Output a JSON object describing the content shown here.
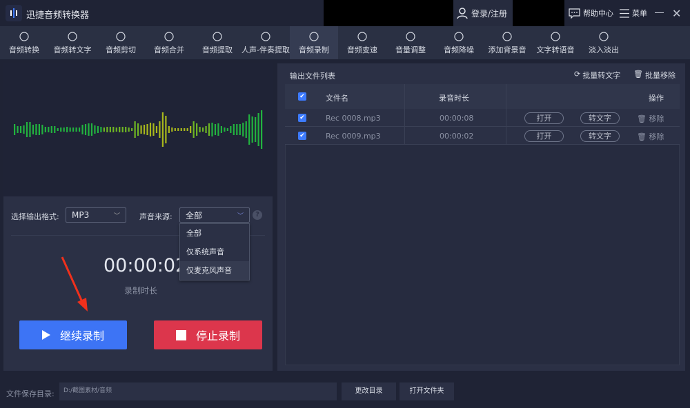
{
  "app": {
    "title": "迅捷音频转换器"
  },
  "titlebar": {
    "login": "登录/注册",
    "help": "帮助中心",
    "menu": "菜单"
  },
  "toolbar": {
    "items": [
      {
        "label": "音频转换",
        "icon": "audio-convert-icon"
      },
      {
        "label": "音频转文字",
        "icon": "speech-to-text-icon"
      },
      {
        "label": "音频剪切",
        "icon": "scissors-icon"
      },
      {
        "label": "音频合并",
        "icon": "merge-icon"
      },
      {
        "label": "音频提取",
        "icon": "extract-icon"
      },
      {
        "label": "人声-伴奏提取",
        "icon": "vocal-separate-icon"
      },
      {
        "label": "音频录制",
        "icon": "microphone-icon",
        "active": true
      },
      {
        "label": "音频变速",
        "icon": "speed-icon"
      },
      {
        "label": "音量调整",
        "icon": "volume-icon"
      },
      {
        "label": "音频降噪",
        "icon": "denoise-icon"
      },
      {
        "label": "添加背景音",
        "icon": "music-icon"
      },
      {
        "label": "文字转语音",
        "icon": "text-to-speech-icon"
      },
      {
        "label": "淡入淡出",
        "icon": "fade-icon"
      }
    ]
  },
  "recorder": {
    "format_label": "选择输出格式:",
    "format_value": "MP3",
    "source_label": "声音来源:",
    "source_value": "全部",
    "source_options": [
      "全部",
      "仅系统声音",
      "仅麦克风声音"
    ],
    "time": "00:00:02",
    "time_label": "录制时长",
    "continue_label": "继续录制",
    "stop_label": "停止录制"
  },
  "filelist": {
    "title": "输出文件列表",
    "batch_text": "批量转文字",
    "batch_remove": "批量移除",
    "headers": {
      "name": "文件名",
      "duration": "录音时长",
      "actions": "操作"
    },
    "rows": [
      {
        "name": "Rec 0008.mp3",
        "duration": "00:00:08",
        "checked": true
      },
      {
        "name": "Rec 0009.mp3",
        "duration": "00:00:02",
        "checked": true
      }
    ],
    "open_label": "打开",
    "to_text_label": "转文字",
    "remove_label": "移除"
  },
  "footer": {
    "label": "文件保存目录:",
    "path": "D:/截图素材/音频",
    "change": "更改目录",
    "open_folder": "打开文件夹"
  },
  "colors": {
    "accent": "#3d74f5",
    "stop": "#dc364c",
    "bg": "#1f2335",
    "panel": "#2b3045"
  }
}
